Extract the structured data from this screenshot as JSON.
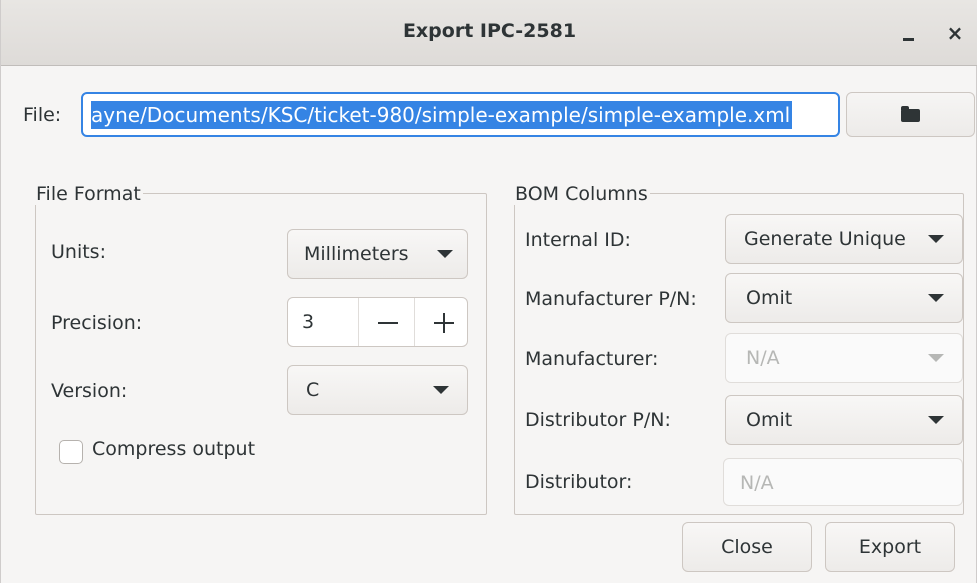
{
  "window": {
    "title": "Export IPC-2581",
    "minimize_label": "–",
    "close_label": "×"
  },
  "file": {
    "label": "File:",
    "value": "ayne/Documents/KSC/ticket-980/simple-example/simple-example.xml",
    "browse_icon": "folder-icon"
  },
  "file_format": {
    "title": "File Format",
    "units_label": "Units:",
    "units_value": "Millimeters",
    "precision_label": "Precision:",
    "precision_value": "3",
    "version_label": "Version:",
    "version_value": "C",
    "compress_label": "Compress output",
    "compress_checked": false
  },
  "bom": {
    "title": "BOM Columns",
    "internal_id_label": "Internal ID:",
    "internal_id_value": "Generate Unique",
    "mfr_pn_label": "Manufacturer P/N:",
    "mfr_pn_value": "Omit",
    "manufacturer_label": "Manufacturer:",
    "manufacturer_value": "N/A",
    "dist_pn_label": "Distributor P/N:",
    "dist_pn_value": "Omit",
    "distributor_label": "Distributor:",
    "distributor_placeholder": "N/A"
  },
  "actions": {
    "close_label": "Close",
    "export_label": "Export"
  },
  "colors": {
    "accent": "#3584e4",
    "window_bg": "#f6f5f4",
    "text": "#2e3436"
  }
}
